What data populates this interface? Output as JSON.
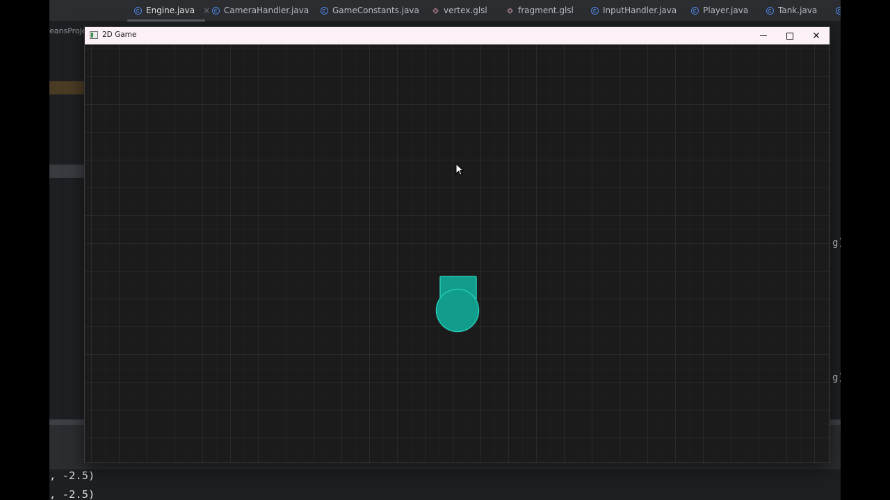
{
  "ide": {
    "tabs": [
      {
        "label": "Engine.java",
        "icon": "java-class-icon",
        "active": true,
        "closable": true
      },
      {
        "label": "CameraHandler.java",
        "icon": "java-class-icon"
      },
      {
        "label": "GameConstants.java",
        "icon": "java-class-icon"
      },
      {
        "label": "vertex.glsl",
        "icon": "glsl-file-icon"
      },
      {
        "label": "fragment.glsl",
        "icon": "glsl-file-icon"
      },
      {
        "label": "InputHandler.java",
        "icon": "java-class-icon"
      },
      {
        "label": "Player.java",
        "icon": "java-class-icon"
      },
      {
        "label": "Tank.java",
        "icon": "java-class-icon"
      }
    ],
    "tab_close_glyph": "×",
    "project_label": "eansProje",
    "right_fragments": [
      "g)",
      "g)"
    ],
    "console_lines": [
      ", -2.5)",
      ", -2.5)"
    ]
  },
  "game_window": {
    "title": "2D Game",
    "controls": {
      "minimize": "minimize-icon",
      "maximize": "maximize-icon",
      "close": "close-icon",
      "close_glyph": "✕"
    },
    "colors": {
      "background": "#1b1b1b",
      "grid": "#2a2a2a",
      "tank_fill": "#119c8c",
      "tank_outline": "#25c9b4",
      "titlebar": "#fbf1f7"
    }
  }
}
